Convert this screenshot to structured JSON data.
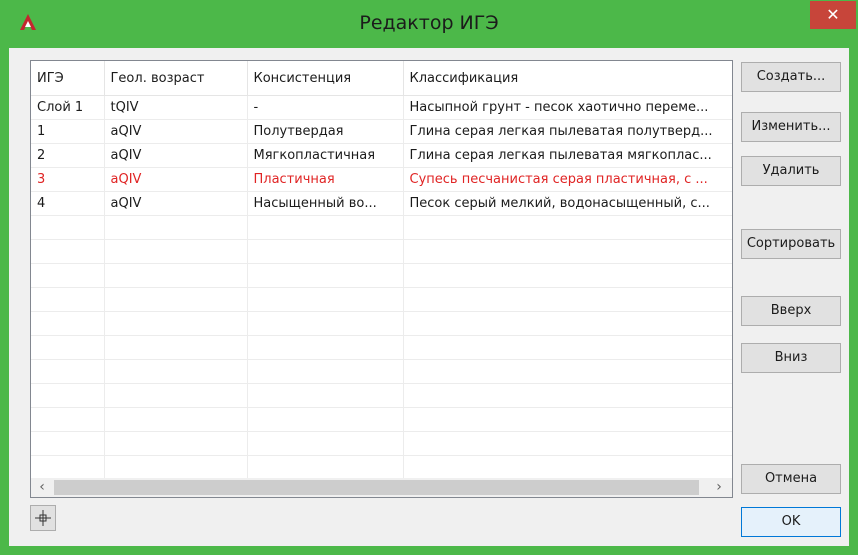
{
  "window": {
    "title": "Редактор ИГЭ",
    "close_glyph": "✕",
    "app_icon": "autocad-icon"
  },
  "grid": {
    "columns": [
      "ИГЭ",
      "Геол. возраст",
      "Консистенция",
      "Классификация"
    ],
    "rows": [
      [
        "Слой 1",
        "tQIV",
        "-",
        "Насыпной грунт - песок хаотично переме..."
      ],
      [
        "1",
        "aQIV",
        "Полутвердая",
        "Глина серая легкая пылеватая полутверд..."
      ],
      [
        "2",
        "aQIV",
        "Мягкопластичная",
        "Глина серая легкая пылеватая мягкоплас..."
      ],
      [
        "3",
        "aQIV",
        "Пластичная",
        "Супесь песчанистая серая пластичная, с ..."
      ],
      [
        "4",
        "aQIV",
        "Насыщенный во...",
        "Песок серый мелкий, водонасыщенный, с..."
      ]
    ],
    "highlighted_row_color": "#e02424",
    "scroll_left_glyph": "‹",
    "scroll_right_glyph": "›"
  },
  "buttons": {
    "create": "Создать...",
    "edit": "Изменить...",
    "delete": "Удалить",
    "sort": "Сортировать",
    "up": "Вверх",
    "down": "Вниз",
    "cancel": "Отмена",
    "ok": "OK"
  },
  "bottom_tool": {
    "icon": "crosshair-pick-icon"
  },
  "colors": {
    "frame": "#4cb849",
    "close": "#c7453a",
    "dialog": "#f0f0f0"
  }
}
